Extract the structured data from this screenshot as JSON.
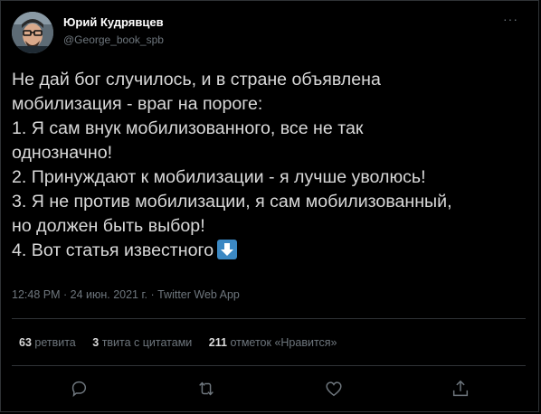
{
  "author": {
    "display_name": "Юрий Кудрявцев",
    "handle": "@George_book_spb"
  },
  "more_label": "···",
  "tweet_lines": [
    "Не дай бог случилось, и в стране объявлена",
    "мобилизация - враг на пороге:",
    "1. Я сам внук мобилизованного, все не так",
    "однозначно!",
    "2. Принуждают к мобилизации - я лучше уволюсь!",
    "3. Я не против мобилизации, я сам мобилизованный,",
    "но должен быть выбор!",
    "4. Вот статья известного"
  ],
  "tweet_emoji": "down-arrow-emoji",
  "meta": "12:48 PM · 24 июн. 2021 г. · Twitter Web App",
  "stats": {
    "retweets_count": "63",
    "retweets_label": "ретвита",
    "quotes_count": "3",
    "quotes_label": "твита с цитатами",
    "likes_count": "211",
    "likes_label": "отметок «Нравится»"
  },
  "actions": [
    "reply-icon",
    "retweet-icon",
    "like-icon",
    "share-icon"
  ],
  "colors": {
    "background": "#000000",
    "text": "#d9d9d9",
    "secondary": "#6e767d",
    "divider": "#2f3336",
    "emoji_blue": "#3b88c3"
  }
}
